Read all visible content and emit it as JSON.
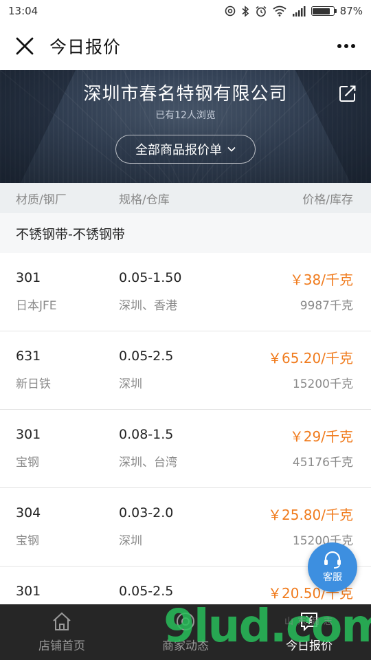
{
  "status_bar": {
    "time": "13:04",
    "battery_text": "87%",
    "battery_level": 0.87
  },
  "header": {
    "title": "今日报价"
  },
  "banner": {
    "company": "深圳市春名特钢有限公司",
    "views": "已有12人浏览",
    "selector_label": "全部商品报价单"
  },
  "columns": {
    "material": "材质/钢厂",
    "spec": "规格/仓库",
    "price": "价格/库存"
  },
  "category": "不锈钢带-不锈钢带",
  "rows": [
    {
      "material": "301",
      "mill": "日本JFE",
      "spec": "0.05-1.50",
      "warehouse": "深圳、香港",
      "price": "￥38/千克",
      "stock": "9987千克"
    },
    {
      "material": "631",
      "mill": "新日铁",
      "spec": "0.05-2.5",
      "warehouse": "深圳",
      "price": "￥65.20/千克",
      "stock": "15200千克"
    },
    {
      "material": "301",
      "mill": "宝钢",
      "spec": "0.08-1.5",
      "warehouse": "深圳、台湾",
      "price": "￥29/千克",
      "stock": "45176千克"
    },
    {
      "material": "304",
      "mill": "宝钢",
      "spec": "0.03-2.0",
      "warehouse": "深圳",
      "price": "￥25.80/千克",
      "stock": "15200千克"
    },
    {
      "material": "301",
      "mill": "",
      "spec": "0.05-2.5",
      "warehouse": "",
      "price": "￥20.50/千克",
      "stock": ""
    }
  ],
  "customer_service": {
    "label": "客服"
  },
  "bottom_nav": [
    {
      "label": "店铺首页",
      "icon": "home-icon"
    },
    {
      "label": "商家动态",
      "icon": "activity-icon"
    },
    {
      "label": "今日报价",
      "icon": "quote-icon",
      "active": true
    }
  ],
  "watermark": {
    "text": "9lud.com",
    "subtext": "山东商志"
  },
  "colors": {
    "price": "#f07b1d",
    "accent_blue": "#3d8fe0",
    "nav_bg": "#262626"
  }
}
